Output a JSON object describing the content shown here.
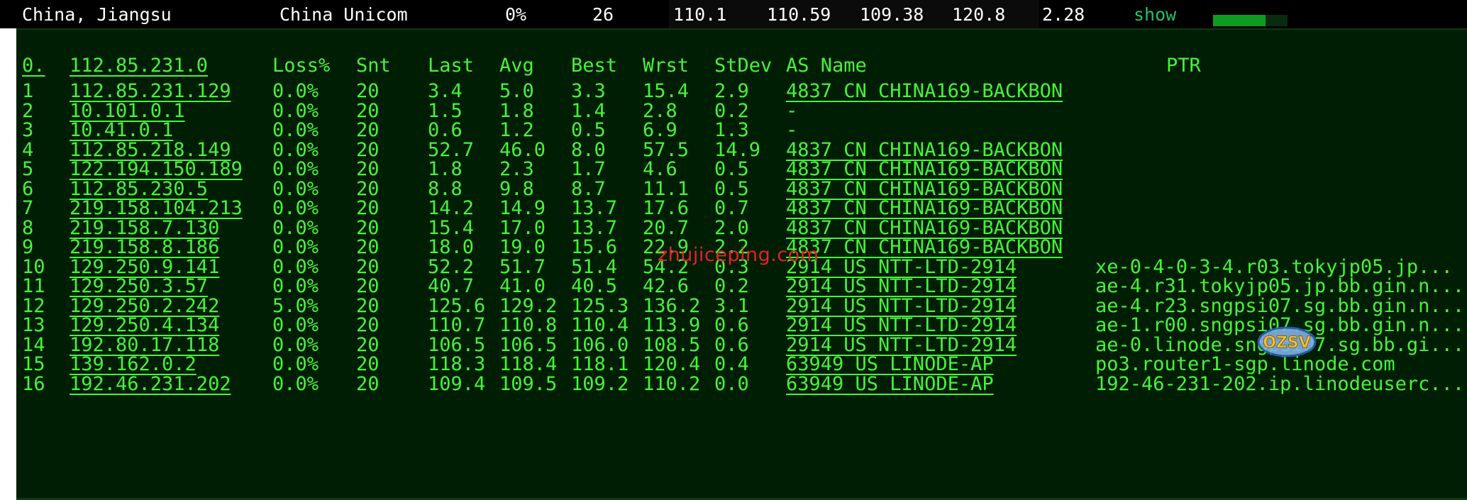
{
  "header": {
    "location": "China, Jiangsu",
    "isp": "China Unicom",
    "loss": "0%",
    "count": "26",
    "last": "110.1",
    "avg": "110.59",
    "best": "109.38",
    "worst": "120.8",
    "stdev": "2.28",
    "show_label": "show",
    "progress_fraction": 0.7
  },
  "columns": {
    "index": "0.",
    "host": "112.85.231.0",
    "loss": "Loss%",
    "snt": "Snt",
    "last": "Last",
    "avg": "Avg",
    "best": "Best",
    "wrst": "Wrst",
    "stdev": "StDev",
    "as_name": "AS Name",
    "ptr": "PTR"
  },
  "hops": [
    {
      "idx": "1",
      "host": "112.85.231.129",
      "loss": "0.0%",
      "snt": "20",
      "last": "3.4",
      "avg": "5.0",
      "best": "3.3",
      "wrst": "15.4",
      "stdev": "2.9",
      "as": "4837  CN CHINA169-BACKBON",
      "ptr": ""
    },
    {
      "idx": "2",
      "host": "10.101.0.1",
      "loss": "0.0%",
      "snt": "20",
      "last": "1.5",
      "avg": "1.8",
      "best": "1.4",
      "wrst": "2.8",
      "stdev": "0.2",
      "as": "-",
      "ptr": ""
    },
    {
      "idx": "3",
      "host": "10.41.0.1",
      "loss": "0.0%",
      "snt": "20",
      "last": "0.6",
      "avg": "1.2",
      "best": "0.5",
      "wrst": "6.9",
      "stdev": "1.3",
      "as": "-",
      "ptr": ""
    },
    {
      "idx": "4",
      "host": "112.85.218.149",
      "loss": "0.0%",
      "snt": "20",
      "last": "52.7",
      "avg": "46.0",
      "best": "8.0",
      "wrst": "57.5",
      "stdev": "14.9",
      "as": "4837  CN CHINA169-BACKBON",
      "ptr": ""
    },
    {
      "idx": "5",
      "host": "122.194.150.189",
      "loss": "0.0%",
      "snt": "20",
      "last": "1.8",
      "avg": "2.3",
      "best": "1.7",
      "wrst": "4.6",
      "stdev": "0.5",
      "as": "4837  CN CHINA169-BACKBON",
      "ptr": ""
    },
    {
      "idx": "6",
      "host": "112.85.230.5",
      "loss": "0.0%",
      "snt": "20",
      "last": "8.8",
      "avg": "9.8",
      "best": "8.7",
      "wrst": "11.1",
      "stdev": "0.5",
      "as": "4837  CN CHINA169-BACKBON",
      "ptr": ""
    },
    {
      "idx": "7",
      "host": "219.158.104.213",
      "loss": "0.0%",
      "snt": "20",
      "last": "14.2",
      "avg": "14.9",
      "best": "13.7",
      "wrst": "17.6",
      "stdev": "0.7",
      "as": "4837  CN CHINA169-BACKBON",
      "ptr": ""
    },
    {
      "idx": "8",
      "host": "219.158.7.130",
      "loss": "0.0%",
      "snt": "20",
      "last": "15.4",
      "avg": "17.0",
      "best": "13.7",
      "wrst": "20.7",
      "stdev": "2.0",
      "as": "4837  CN CHINA169-BACKBON",
      "ptr": ""
    },
    {
      "idx": "9",
      "host": "219.158.8.186",
      "loss": "0.0%",
      "snt": "20",
      "last": "18.0",
      "avg": "19.0",
      "best": "15.6",
      "wrst": "22.9",
      "stdev": "2.2",
      "as": "4837  CN CHINA169-BACKBON",
      "ptr": ""
    },
    {
      "idx": "10",
      "host": "129.250.9.141",
      "loss": "0.0%",
      "snt": "20",
      "last": "52.2",
      "avg": "51.7",
      "best": "51.4",
      "wrst": "54.2",
      "stdev": "0.3",
      "as": "2914  US NTT-LTD-2914",
      "ptr": "xe-0-4-0-3-4.r03.tokyjp05.jp..."
    },
    {
      "idx": "11",
      "host": "129.250.3.57",
      "loss": "0.0%",
      "snt": "20",
      "last": "40.7",
      "avg": "41.0",
      "best": "40.5",
      "wrst": "42.6",
      "stdev": "0.2",
      "as": "2914  US NTT-LTD-2914",
      "ptr": "ae-4.r31.tokyjp05.jp.bb.gin.n..."
    },
    {
      "idx": "12",
      "host": "129.250.2.242",
      "loss": "5.0%",
      "snt": "20",
      "last": "125.6",
      "avg": "129.2",
      "best": "125.3",
      "wrst": "136.2",
      "stdev": "3.1",
      "as": "2914  US NTT-LTD-2914",
      "ptr": "ae-4.r23.sngpsi07.sg.bb.gin.n..."
    },
    {
      "idx": "13",
      "host": "129.250.4.134",
      "loss": "0.0%",
      "snt": "20",
      "last": "110.7",
      "avg": "110.8",
      "best": "110.4",
      "wrst": "113.9",
      "stdev": "0.6",
      "as": "2914  US NTT-LTD-2914",
      "ptr": "ae-1.r00.sngpsi07.sg.bb.gin.n..."
    },
    {
      "idx": "14",
      "host": "192.80.17.118",
      "loss": "0.0%",
      "snt": "20",
      "last": "106.5",
      "avg": "106.5",
      "best": "106.0",
      "wrst": "108.5",
      "stdev": "0.6",
      "as": "2914  US NTT-LTD-2914",
      "ptr": "ae-0.linode.sngpsi07.sg.bb.gi..."
    },
    {
      "idx": "15",
      "host": "139.162.0.2",
      "loss": "0.0%",
      "snt": "20",
      "last": "118.3",
      "avg": "118.4",
      "best": "118.1",
      "wrst": "120.4",
      "stdev": "0.4",
      "as": "63949 US LINODE-AP",
      "ptr": "po3.router1-sgp.linode.com"
    },
    {
      "idx": "16",
      "host": "192.46.231.202",
      "loss": "0.0%",
      "snt": "20",
      "last": "109.4",
      "avg": "109.5",
      "best": "109.2",
      "wrst": "110.2",
      "stdev": "0.0",
      "as": "63949 US LINODE-AP",
      "ptr": "192-46-231-202.ip.linodeuserc..."
    }
  ],
  "watermarks": {
    "site": "zhujiceping.com",
    "logo": "OZSV"
  },
  "colors": {
    "terminal_bg": "#001e04",
    "terminal_text": "#48f23a",
    "watermark_red": "#e8202a",
    "progress_green": "#0f9c1e"
  }
}
